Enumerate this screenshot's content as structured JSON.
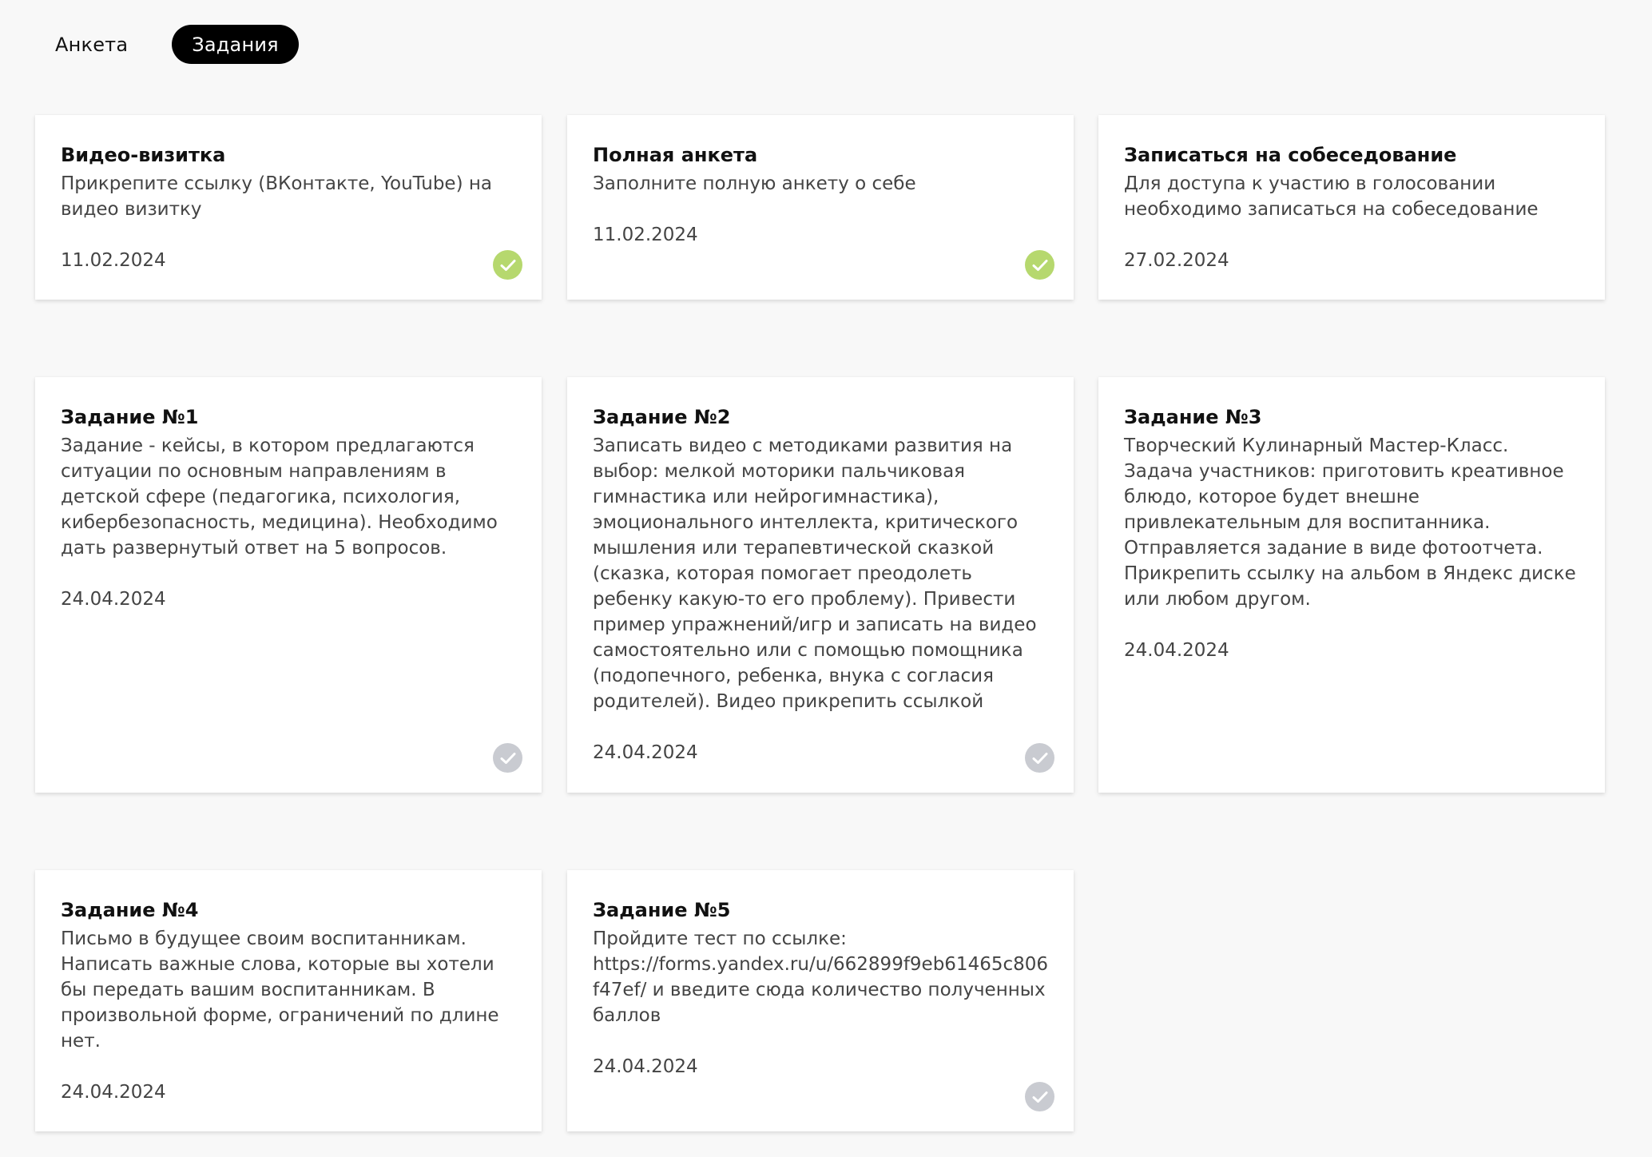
{
  "tabs": {
    "profile": "Анкета",
    "tasks": "Задания",
    "active": "tasks"
  },
  "colors": {
    "done": "#b6d86e",
    "pending": "#c9cbd1"
  },
  "cards": [
    {
      "title": "Видео-визитка",
      "description": "Прикрепите ссылку (ВКонтакте, YouTube) на видео визитку",
      "date": "11.02.2024",
      "status": "done",
      "status_icon": "check-circle-icon"
    },
    {
      "title": "Полная анкета",
      "description": "Заполните полную анкету о себе",
      "date": "11.02.2024",
      "status": "done",
      "status_icon": "check-circle-icon"
    },
    {
      "title": "Записаться на собеседование",
      "description": "Для доступа к участию в голосовании необходимо записаться на собеседование",
      "date": "27.02.2024",
      "status": "none"
    },
    {
      "title": "Задание №1",
      "description": "Задание - кейсы, в котором предлагаются ситуации по основным направлениям в детской сфере (педагогика, психология, кибербезопасность, медицина). Необходимо дать развернутый ответ на 5 вопросов.",
      "date": "24.04.2024",
      "status": "pending",
      "status_icon": "check-circle-icon"
    },
    {
      "title": "Задание №2",
      "description": "Записать видео с методиками развития на выбор: мелкой моторики пальчиковая гимнастика или нейрогимнастика), эмоционального интеллекта, критического мышления или терапевтической сказкой (сказка, которая помогает преодолеть ребенку какую-то его проблему). Привести пример упражнений/игр и записать на видео самостоятельно или с помощью помощника (подопечного, ребенка, внука с согласия родителей). Видео прикрепить ссылкой",
      "date": "24.04.2024",
      "status": "pending",
      "status_icon": "check-circle-icon"
    },
    {
      "title": "Задание №3",
      "description": "Творческий Кулинарный Мастер-Класс. Задача участников: приготовить креативное блюдо, которое будет внешне привлекательным для воспитанника. Отправляется задание в виде фотоотчета. Прикрепить ссылку на альбом в Яндекс диске или любом другом.",
      "date": "24.04.2024",
      "status": "none"
    },
    {
      "title": "Задание №4",
      "description": "Письмо в будущее своим воспитанникам. Написать важные слова, которые вы хотели бы передать вашим воспитанникам. В произвольной форме, ограничений по длине нет.",
      "date": "24.04.2024",
      "status": "none"
    },
    {
      "title": "Задание №5",
      "description": "Пройдите тест по ссылке: https://forms.yandex.ru/u/662899f9eb61465c806f47ef/ и введите сюда количество полученных баллов",
      "date": "24.04.2024",
      "status": "pending",
      "status_icon": "check-circle-icon"
    }
  ]
}
